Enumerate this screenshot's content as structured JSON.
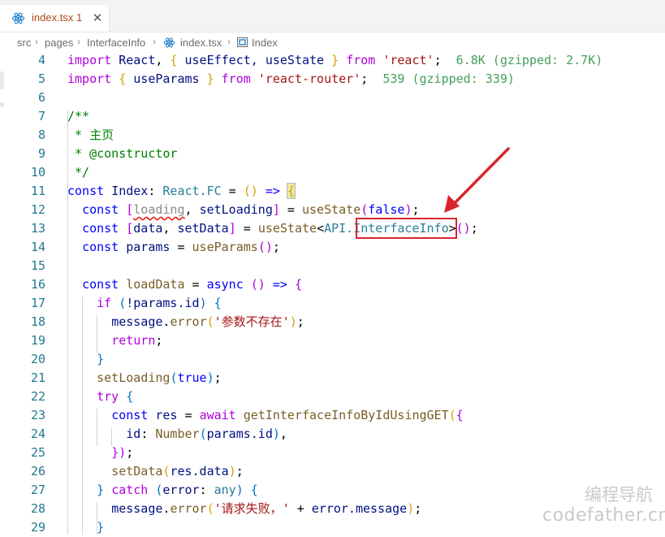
{
  "tab": {
    "filename": "index.tsx",
    "problem_count": "1",
    "close_glyph": "✕"
  },
  "breadcrumb": {
    "items": [
      "src",
      "pages",
      "InterfaceInfo",
      "index.tsx",
      "Index"
    ],
    "separator": "›"
  },
  "code": {
    "line_numbers": [
      "4",
      "5",
      "6",
      "7",
      "8",
      "9",
      "10",
      "11",
      "12",
      "13",
      "14",
      "15",
      "16",
      "17",
      "18",
      "19",
      "20",
      "21",
      "22",
      "23",
      "24",
      "25",
      "26",
      "27",
      "28",
      "29"
    ],
    "lines": [
      {
        "import_kw": "import",
        "name": "React",
        "lbrace": "{",
        "hooks": "useEffect, useState",
        "rbrace": "}",
        "from_kw": "from",
        "module": "'react'",
        "hint": "6.8K (gzipped: 2.7K)"
      },
      {
        "import_kw": "import",
        "lbrace": "{",
        "hook": "useParams",
        "rbrace": "}",
        "from_kw": "from",
        "module": "'react-router'",
        "hint": "539 (gzipped: 339)"
      },
      {},
      {
        "text": "/**"
      },
      {
        "text": " * 主页"
      },
      {
        "text": " * @constructor"
      },
      {
        "text": " */"
      },
      {
        "const_kw": "const",
        "name": "Index",
        "type": "React.FC",
        "params": "()",
        "arrow": "=>",
        "brace": "{"
      },
      {
        "const_kw": "const",
        "lb": "[",
        "first": "loading",
        "second": "setLoading",
        "rb": "]",
        "call": "useState",
        "arg": "false"
      },
      {
        "const_kw": "const",
        "lb": "[",
        "first": "data",
        "second": "setData",
        "rb": "]",
        "call": "useState",
        "generic_ns": "API.",
        "generic_type": "InterfaceInfo"
      },
      {
        "const_kw": "const",
        "name": "params",
        "call": "useParams"
      },
      {},
      {
        "const_kw": "const",
        "name": "loadData",
        "async_kw": "async",
        "arrow": "=>",
        "brace": "{"
      },
      {
        "if_kw": "if",
        "cond": "!params.id"
      },
      {
        "obj": "message",
        "method": "error",
        "arg": "'参数不存在'"
      },
      {
        "kw": "return"
      },
      {
        "brace": "}"
      },
      {
        "call": "setLoading",
        "arg": "true"
      },
      {
        "kw": "try",
        "brace": "{"
      },
      {
        "const_kw": "const",
        "name": "res",
        "await_kw": "await",
        "call": "getInterfaceInfoByIdUsingGET"
      },
      {
        "key": "id",
        "call": "Number",
        "arg": "params.id"
      },
      {
        "close": "})"
      },
      {
        "call": "setData",
        "arg": "res.data"
      },
      {
        "kw": "catch",
        "param": "error",
        "type": "any"
      },
      {
        "obj": "message",
        "method": "error",
        "arg": "'请求失败，'",
        "rest": "error.message"
      },
      {
        "brace": "}"
      }
    ]
  },
  "annotation": {
    "color": "#d9262c"
  },
  "watermark": {
    "cn": "编程导航",
    "en": "codefather.cn"
  }
}
